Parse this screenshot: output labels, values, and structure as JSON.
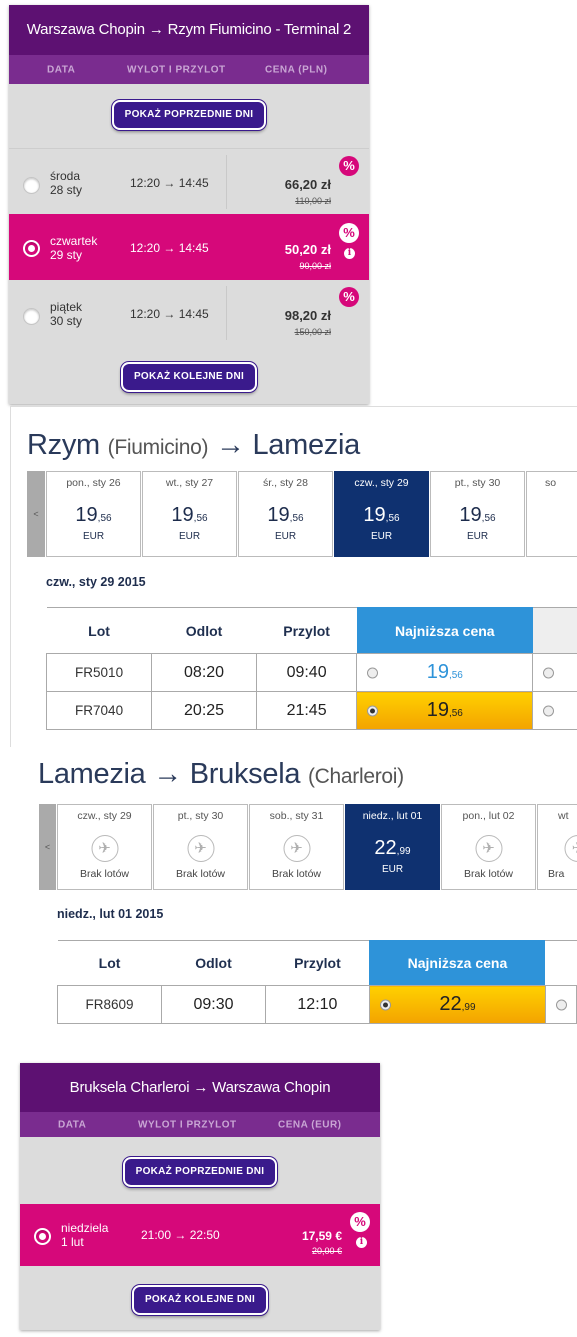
{
  "panel1": {
    "route": "Warszawa Chopin → Rzym Fiumicino - Terminal 2",
    "columns": [
      "DATA",
      "WYLOT I PRZYLOT",
      "CENA (PLN)"
    ],
    "prev_button": "POKAŻ POPRZEDNIE DNI",
    "next_button": "POKAŻ KOLEJNE DNI",
    "rows": [
      {
        "weekday": "środa",
        "date": "28 sty",
        "time": "12:20 → 14:45",
        "price": "66,20 zł",
        "old_price": "110,00 zł",
        "badge": "%"
      },
      {
        "weekday": "czwartek",
        "date": "29 sty",
        "time": "12:20 → 14:45",
        "price": "50,20 zł",
        "old_price": "90,00 zł",
        "badge": "%",
        "info": "i",
        "selected": true
      },
      {
        "weekday": "piątek",
        "date": "30 sty",
        "time": "12:20 → 14:45",
        "price": "98,20 zł",
        "old_price": "150,00 zł",
        "badge": "%"
      }
    ]
  },
  "panel2": {
    "title_from": "Rzym",
    "title_from_paren": "(Fiumicino)",
    "title_arrow": "→",
    "title_to": "Lamezia",
    "prev_arrow": "<",
    "days": [
      {
        "label": "pon., sty 26",
        "price_int": "19",
        "price_dec": ",56",
        "currency": "EUR"
      },
      {
        "label": "wt., sty 27",
        "price_int": "19",
        "price_dec": ",56",
        "currency": "EUR"
      },
      {
        "label": "śr., sty 28",
        "price_int": "19",
        "price_dec": ",56",
        "currency": "EUR"
      },
      {
        "label": "czw., sty 29",
        "price_int": "19",
        "price_dec": ",56",
        "currency": "EUR",
        "active": true
      },
      {
        "label": "pt., sty 30",
        "price_int": "19",
        "price_dec": ",56",
        "currency": "EUR"
      },
      {
        "label": "so",
        "price_int": "",
        "price_dec": "",
        "currency": ""
      }
    ],
    "selected_date": "czw., sty 29 2015",
    "headers": {
      "flight": "Lot",
      "depart": "Odlot",
      "arrive": "Przylot",
      "lowest": "Najniższa cena"
    },
    "flights": [
      {
        "no": "FR5010",
        "depart": "08:20",
        "arrive": "09:40",
        "price_int": "19",
        "price_dec": ",56",
        "selected": false
      },
      {
        "no": "FR7040",
        "depart": "20:25",
        "arrive": "21:45",
        "price_int": "19",
        "price_dec": ",56",
        "selected": true
      }
    ]
  },
  "panel3": {
    "title_from": "Lamezia",
    "title_arrow": "→",
    "title_to": "Bruksela",
    "title_to_paren": "(Charleroi)",
    "prev_arrow": "<",
    "days": [
      {
        "label": "czw., sty 29",
        "no_flights": "Brak lotów"
      },
      {
        "label": "pt., sty 30",
        "no_flights": "Brak lotów"
      },
      {
        "label": "sob., sty 31",
        "no_flights": "Brak lotów"
      },
      {
        "label": "niedz., lut 01",
        "price_int": "22",
        "price_dec": ",99",
        "currency": "EUR",
        "active": true
      },
      {
        "label": "pon., lut 02",
        "no_flights": "Brak lotów"
      },
      {
        "label": "wt",
        "no_flights": "Bra"
      }
    ],
    "selected_date": "niedz., lut 01 2015",
    "headers": {
      "flight": "Lot",
      "depart": "Odlot",
      "arrive": "Przylot",
      "lowest": "Najniższa cena"
    },
    "flights": [
      {
        "no": "FR8609",
        "depart": "09:30",
        "arrive": "12:10",
        "price_int": "22",
        "price_dec": ",99",
        "selected": true
      }
    ]
  },
  "panel4": {
    "route": "Bruksela Charleroi → Warszawa Chopin",
    "columns": [
      "DATA",
      "WYLOT I PRZYLOT",
      "CENA (EUR)"
    ],
    "prev_button": "POKAŻ POPRZEDNIE DNI",
    "next_button": "POKAŻ KOLEJNE DNI",
    "rows": [
      {
        "weekday": "niedziela",
        "date": "1 lut",
        "time": "21:00 → 22:50",
        "price": "17,59 €",
        "old_price": "20,00 €",
        "badge": "%",
        "info": "i",
        "selected": true
      }
    ]
  }
}
